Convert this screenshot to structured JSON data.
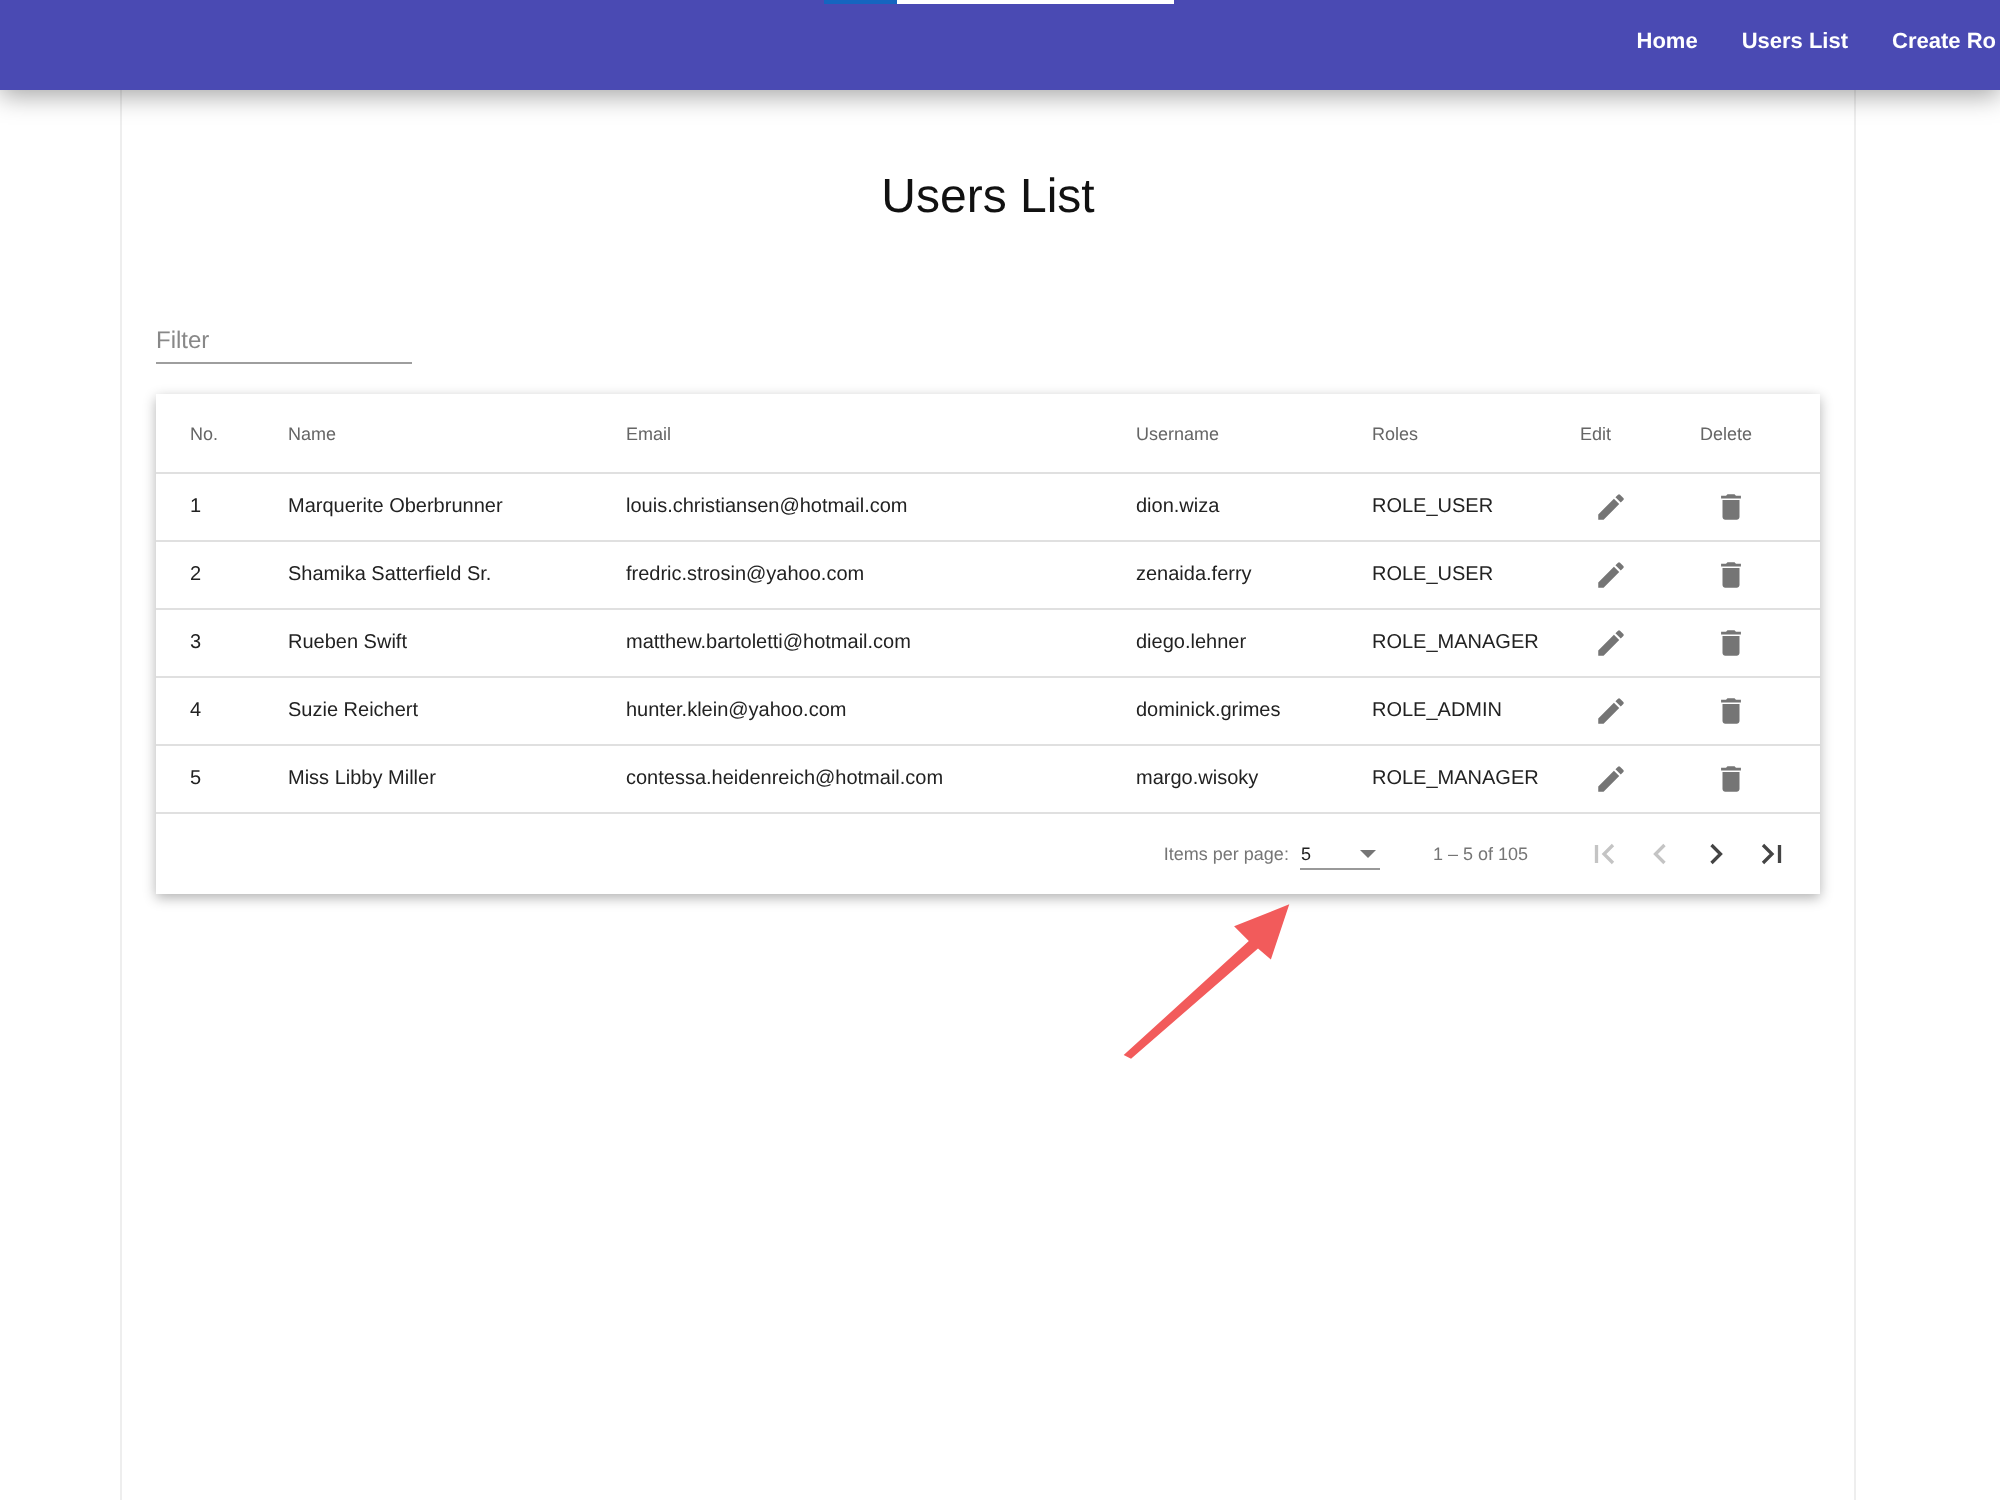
{
  "nav": [
    {
      "label": "Home"
    },
    {
      "label": "Users List"
    },
    {
      "label": "Create Ro"
    }
  ],
  "title": "Users List",
  "filter": {
    "placeholder": "Filter"
  },
  "table": {
    "columns": [
      "No.",
      "Name",
      "Email",
      "Username",
      "Roles",
      "Edit",
      "Delete"
    ],
    "rows": [
      {
        "no": "1",
        "name": "Marquerite Oberbrunner",
        "email": "louis.christiansen@hotmail.com",
        "username": "dion.wiza",
        "role": "ROLE_USER"
      },
      {
        "no": "2",
        "name": "Shamika Satterfield Sr.",
        "email": "fredric.strosin@yahoo.com",
        "username": "zenaida.ferry",
        "role": "ROLE_USER"
      },
      {
        "no": "3",
        "name": "Rueben Swift",
        "email": "matthew.bartoletti@hotmail.com",
        "username": "diego.lehner",
        "role": "ROLE_MANAGER"
      },
      {
        "no": "4",
        "name": "Suzie Reichert",
        "email": "hunter.klein@yahoo.com",
        "username": "dominick.grimes",
        "role": "ROLE_ADMIN"
      },
      {
        "no": "5",
        "name": "Miss Libby Miller",
        "email": "contessa.heidenreich@hotmail.com",
        "username": "margo.wisoky",
        "role": "ROLE_MANAGER"
      }
    ]
  },
  "paginator": {
    "items_label": "Items per page:",
    "page_size": "5",
    "range": "1 – 5 of 105",
    "buttons": [
      {
        "kind": "first",
        "disabled": true
      },
      {
        "kind": "previous",
        "disabled": true
      },
      {
        "kind": "next",
        "disabled": false
      },
      {
        "kind": "last",
        "disabled": false
      }
    ]
  }
}
